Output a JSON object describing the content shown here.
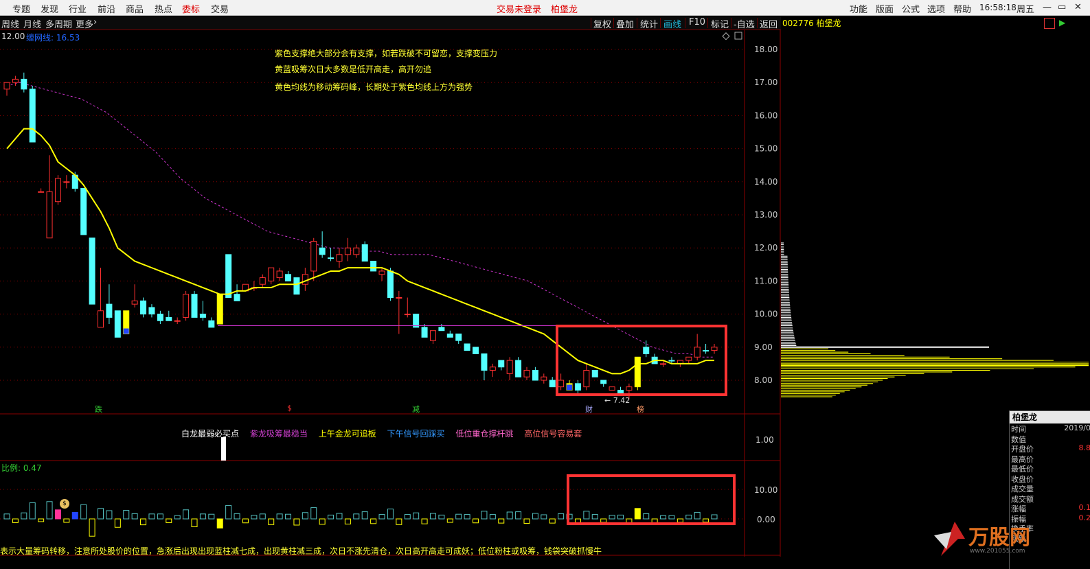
{
  "topbar": {
    "menus": [
      "专题",
      "发现",
      "行业",
      "前沿",
      "商品",
      "热点",
      "委标",
      "交易"
    ],
    "active_menu": "委标",
    "trade_status": "交易未登录",
    "stock_name": "柏堡龙",
    "right_menus": [
      "功能",
      "版面",
      "公式",
      "选项",
      "帮助"
    ],
    "time": "16:58:18",
    "weekday": "周五"
  },
  "toolbar": {
    "left_items": [
      "周线",
      "月线",
      "多周期",
      "更多"
    ],
    "right_buttons": [
      "复权",
      "叠加",
      "统计",
      "画线",
      "F10",
      "标记",
      "-自选",
      "返回"
    ],
    "active_button": "画线",
    "stock_code_label": "002776 柏堡龙"
  },
  "main_chart": {
    "top_label": "12.00",
    "indicator_label": "缠网线: 16.53",
    "annotations": [
      "紫色支撑绝大部分会有支撑，如若跌破不可留恋，支撑变压力",
      "黄蓝吸筹次日大多数是低开高走，高开勿追",
      "黄色均线为移动筹码峰，长期处于紫色均线上方为强势"
    ],
    "price_ticks": [
      "18.00",
      "17.00",
      "16.00",
      "15.00",
      "14.00",
      "13.00",
      "12.00",
      "11.00",
      "10.00",
      "9.00",
      "8.00"
    ],
    "low_label": "← 7.42",
    "event_markers": [
      "跌",
      "$",
      "减",
      "财",
      "榜"
    ]
  },
  "signal_panel": {
    "labels": [
      {
        "text": "白龙最弱必买点",
        "color": "#ffffff"
      },
      {
        "text": "紫龙吸筹最稳当",
        "color": "#d040d0"
      },
      {
        "text": "上午金龙可追板",
        "color": "#ffff00"
      },
      {
        "text": "下午信号回踩买",
        "color": "#3399ff"
      },
      {
        "text": "低位重仓撑杆跳",
        "color": "#ff66cc"
      },
      {
        "text": "高位信号容易套",
        "color": "#ff6666"
      }
    ],
    "tick": "1.00"
  },
  "volume_panel": {
    "ratio_label": "比例: 0.47",
    "ticks": [
      "10.00",
      "0.00"
    ],
    "bottom_note": "表示大量筹码转移，注意所处股价的位置，急涨后出现出现蓝柱减七成，出现黄柱减三成，次日不涨先清仓，次日高开高走可成妖；低位粉柱或吸筹，钱袋突破抓慢牛"
  },
  "info_panel": {
    "title": "柏堡龙",
    "rows": [
      {
        "label": "时间",
        "value": "2019/0"
      },
      {
        "label": "数值",
        "value": ""
      },
      {
        "label": "开盘价",
        "value": "8.8"
      },
      {
        "label": "最高价",
        "value": ""
      },
      {
        "label": "最低价",
        "value": ""
      },
      {
        "label": "收盘价",
        "value": ""
      },
      {
        "label": "成交量",
        "value": ""
      },
      {
        "label": "成交额",
        "value": ""
      },
      {
        "label": "涨幅",
        "value": "0.1"
      },
      {
        "label": "振幅",
        "value": "0.2"
      },
      {
        "label": "换手率",
        "value": ""
      },
      {
        "label": "涨跌",
        "value": ""
      }
    ]
  },
  "watermark": {
    "text": "万股网",
    "url": "www.201055.com"
  },
  "chart_data": {
    "type": "candlestick",
    "price_range": [
      7.0,
      18.5
    ],
    "candles": [
      {
        "o": 16.8,
        "h": 17.0,
        "l": 16.6,
        "c": 17.0,
        "col": "red"
      },
      {
        "o": 17.0,
        "h": 17.2,
        "l": 16.9,
        "c": 17.1,
        "col": "red"
      },
      {
        "o": 17.1,
        "h": 17.3,
        "l": 16.7,
        "c": 16.8,
        "col": "cyan"
      },
      {
        "o": 16.8,
        "h": 16.9,
        "l": 15.2,
        "c": 15.2,
        "col": "cyan"
      },
      {
        "o": 13.7,
        "h": 13.8,
        "l": 13.7,
        "c": 13.7,
        "col": "red"
      },
      {
        "o": 12.3,
        "h": 14.8,
        "l": 12.3,
        "c": 13.7,
        "col": "red"
      },
      {
        "o": 13.4,
        "h": 14.2,
        "l": 13.3,
        "c": 14.1,
        "col": "red"
      },
      {
        "o": 14.0,
        "h": 14.2,
        "l": 13.8,
        "c": 14.0,
        "col": "red"
      },
      {
        "o": 14.2,
        "h": 14.3,
        "l": 13.7,
        "c": 13.8,
        "col": "cyan"
      },
      {
        "o": 13.8,
        "h": 13.8,
        "l": 12.4,
        "c": 12.4,
        "col": "cyan"
      },
      {
        "o": 12.3,
        "h": 12.3,
        "l": 10.3,
        "c": 10.3,
        "col": "cyan"
      },
      {
        "o": 9.6,
        "h": 11.4,
        "l": 9.6,
        "c": 10.1,
        "col": "red"
      },
      {
        "o": 10.3,
        "h": 10.9,
        "l": 9.7,
        "c": 9.9,
        "col": "cyan"
      },
      {
        "o": 10.1,
        "h": 10.1,
        "l": 9.3,
        "c": 9.3,
        "col": "cyan"
      },
      {
        "o": 9.4,
        "h": 10.1,
        "l": 9.4,
        "c": 10.1,
        "col": "yellowblue"
      },
      {
        "o": 10.3,
        "h": 10.9,
        "l": 10.2,
        "c": 10.4,
        "col": "red"
      },
      {
        "o": 10.4,
        "h": 10.5,
        "l": 9.9,
        "c": 10.0,
        "col": "cyan"
      },
      {
        "o": 10.2,
        "h": 10.3,
        "l": 9.9,
        "c": 10.0,
        "col": "cyan"
      },
      {
        "o": 10.0,
        "h": 10.1,
        "l": 9.7,
        "c": 9.8,
        "col": "cyan"
      },
      {
        "o": 9.8,
        "h": 10.1,
        "l": 9.8,
        "c": 9.9,
        "col": "cyan"
      },
      {
        "o": 9.8,
        "h": 9.9,
        "l": 9.7,
        "c": 9.8,
        "col": "red"
      },
      {
        "o": 9.9,
        "h": 10.7,
        "l": 9.8,
        "c": 10.6,
        "col": "red"
      },
      {
        "o": 10.6,
        "h": 10.7,
        "l": 9.9,
        "c": 9.9,
        "col": "cyan"
      },
      {
        "o": 10.0,
        "h": 10.4,
        "l": 9.8,
        "c": 9.9,
        "col": "cyan"
      },
      {
        "o": 9.8,
        "h": 9.9,
        "l": 9.6,
        "c": 9.6,
        "col": "cyan"
      },
      {
        "o": 9.7,
        "h": 10.6,
        "l": 9.7,
        "c": 10.6,
        "col": "yellow"
      },
      {
        "o": 11.8,
        "h": 11.8,
        "l": 10.5,
        "c": 10.5,
        "col": "cyan"
      },
      {
        "o": 10.6,
        "h": 10.9,
        "l": 10.4,
        "c": 10.4,
        "col": "cyan"
      },
      {
        "o": 10.7,
        "h": 10.9,
        "l": 10.7,
        "c": 10.9,
        "col": "red"
      },
      {
        "o": 10.8,
        "h": 11.0,
        "l": 10.7,
        "c": 10.8,
        "col": "red"
      },
      {
        "o": 10.9,
        "h": 11.2,
        "l": 10.8,
        "c": 11.1,
        "col": "red"
      },
      {
        "o": 11.0,
        "h": 11.4,
        "l": 10.9,
        "c": 11.4,
        "col": "red"
      },
      {
        "o": 11.3,
        "h": 11.4,
        "l": 11.0,
        "c": 11.1,
        "col": "red"
      },
      {
        "o": 11.2,
        "h": 11.3,
        "l": 11.0,
        "c": 11.0,
        "col": "cyan"
      },
      {
        "o": 11.1,
        "h": 11.1,
        "l": 10.6,
        "c": 10.6,
        "col": "cyan"
      },
      {
        "o": 10.9,
        "h": 11.4,
        "l": 10.7,
        "c": 11.2,
        "col": "red"
      },
      {
        "o": 11.3,
        "h": 12.3,
        "l": 11.0,
        "c": 12.2,
        "col": "red"
      },
      {
        "o": 12.0,
        "h": 12.5,
        "l": 11.7,
        "c": 11.8,
        "col": "cyan"
      },
      {
        "o": 11.7,
        "h": 12.0,
        "l": 11.6,
        "c": 11.7,
        "col": "cyan"
      },
      {
        "o": 11.6,
        "h": 12.0,
        "l": 11.4,
        "c": 11.8,
        "col": "red"
      },
      {
        "o": 11.8,
        "h": 12.3,
        "l": 11.6,
        "c": 12.0,
        "col": "red"
      },
      {
        "o": 12.0,
        "h": 12.1,
        "l": 11.7,
        "c": 11.8,
        "col": "red"
      },
      {
        "o": 12.1,
        "h": 12.2,
        "l": 11.6,
        "c": 11.6,
        "col": "cyan"
      },
      {
        "o": 11.6,
        "h": 11.6,
        "l": 11.3,
        "c": 11.3,
        "col": "cyan"
      },
      {
        "o": 11.3,
        "h": 11.4,
        "l": 11.0,
        "c": 11.2,
        "col": "red"
      },
      {
        "o": 11.3,
        "h": 11.4,
        "l": 10.4,
        "c": 10.5,
        "col": "cyan"
      },
      {
        "o": 10.5,
        "h": 10.7,
        "l": 9.4,
        "c": 10.5,
        "col": "red"
      },
      {
        "o": 10.0,
        "h": 10.5,
        "l": 9.9,
        "c": 10.0,
        "col": "red"
      },
      {
        "o": 10.0,
        "h": 10.0,
        "l": 9.6,
        "c": 9.6,
        "col": "cyan"
      },
      {
        "o": 9.6,
        "h": 9.7,
        "l": 9.3,
        "c": 9.3,
        "col": "cyan"
      },
      {
        "o": 9.5,
        "h": 9.5,
        "l": 9.1,
        "c": 9.2,
        "col": "red"
      },
      {
        "o": 9.6,
        "h": 9.7,
        "l": 9.5,
        "c": 9.5,
        "col": "cyan"
      },
      {
        "o": 9.4,
        "h": 9.5,
        "l": 9.3,
        "c": 9.3,
        "col": "cyan"
      },
      {
        "o": 9.4,
        "h": 9.4,
        "l": 9.1,
        "c": 9.2,
        "col": "cyan"
      },
      {
        "o": 9.1,
        "h": 9.1,
        "l": 8.9,
        "c": 8.9,
        "col": "cyan"
      },
      {
        "o": 9.0,
        "h": 9.0,
        "l": 8.8,
        "c": 8.8,
        "col": "cyan"
      },
      {
        "o": 8.8,
        "h": 8.8,
        "l": 8.0,
        "c": 8.3,
        "col": "cyan"
      },
      {
        "o": 8.3,
        "h": 8.5,
        "l": 8.1,
        "c": 8.4,
        "col": "red"
      },
      {
        "o": 8.6,
        "h": 8.6,
        "l": 8.3,
        "c": 8.4,
        "col": "cyan"
      },
      {
        "o": 8.2,
        "h": 8.7,
        "l": 8.0,
        "c": 8.6,
        "col": "red"
      },
      {
        "o": 8.6,
        "h": 8.7,
        "l": 8.1,
        "c": 8.1,
        "col": "cyan"
      },
      {
        "o": 8.1,
        "h": 8.4,
        "l": 8.0,
        "c": 8.3,
        "col": "red"
      },
      {
        "o": 8.3,
        "h": 8.4,
        "l": 8.0,
        "c": 8.0,
        "col": "cyan"
      },
      {
        "o": 8.0,
        "h": 8.2,
        "l": 7.9,
        "c": 8.1,
        "col": "red"
      },
      {
        "o": 8.0,
        "h": 8.1,
        "l": 7.8,
        "c": 7.8,
        "col": "cyan"
      },
      {
        "o": 7.8,
        "h": 8.2,
        "l": 7.7,
        "c": 8.0,
        "col": "red"
      },
      {
        "o": 7.9,
        "h": 8.0,
        "l": 7.7,
        "c": 7.7,
        "col": "yellowblue"
      },
      {
        "o": 7.7,
        "h": 8.0,
        "l": 7.6,
        "c": 7.9,
        "col": "cyan"
      },
      {
        "o": 7.8,
        "h": 8.5,
        "l": 7.7,
        "c": 8.3,
        "col": "red"
      },
      {
        "o": 8.3,
        "h": 8.3,
        "l": 8.1,
        "c": 8.1,
        "col": "cyan"
      },
      {
        "o": 8.0,
        "h": 8.0,
        "l": 7.8,
        "c": 7.9,
        "col": "cyan"
      },
      {
        "o": 7.8,
        "h": 7.8,
        "l": 7.7,
        "c": 7.7,
        "col": "red"
      },
      {
        "o": 7.7,
        "h": 7.8,
        "l": 7.6,
        "c": 7.6,
        "col": "cyan"
      },
      {
        "o": 7.7,
        "h": 7.9,
        "l": 7.42,
        "c": 7.8,
        "col": "red"
      },
      {
        "o": 7.8,
        "h": 8.7,
        "l": 7.7,
        "c": 8.7,
        "col": "yellow"
      },
      {
        "o": 8.8,
        "h": 9.2,
        "l": 8.7,
        "c": 9.0,
        "col": "cyan"
      },
      {
        "o": 8.7,
        "h": 8.8,
        "l": 8.5,
        "c": 8.5,
        "col": "cyan"
      },
      {
        "o": 8.5,
        "h": 8.6,
        "l": 8.4,
        "c": 8.5,
        "col": "red"
      },
      {
        "o": 8.6,
        "h": 8.7,
        "l": 8.5,
        "c": 8.6,
        "col": "cyan"
      },
      {
        "o": 8.5,
        "h": 8.6,
        "l": 8.4,
        "c": 8.6,
        "col": "red"
      },
      {
        "o": 8.6,
        "h": 8.7,
        "l": 8.5,
        "c": 8.7,
        "col": "red"
      },
      {
        "o": 8.7,
        "h": 9.4,
        "l": 8.6,
        "c": 9.0,
        "col": "red"
      },
      {
        "o": 8.9,
        "h": 9.1,
        "l": 8.8,
        "c": 8.9,
        "col": "cyan"
      },
      {
        "o": 8.9,
        "h": 9.1,
        "l": 8.8,
        "c": 9.0,
        "col": "red"
      }
    ],
    "ma_yellow": [
      15.0,
      15.3,
      15.6,
      15.6,
      15.4,
      15.1,
      14.6,
      14.4,
      14.2,
      13.9,
      13.5,
      13.1,
      12.6,
      12.0,
      11.8,
      11.6,
      11.5,
      11.4,
      11.3,
      11.2,
      11.1,
      11.0,
      10.9,
      10.8,
      10.7,
      10.6,
      10.6,
      10.7,
      10.7,
      10.8,
      10.8,
      10.8,
      10.9,
      10.9,
      10.9,
      11.0,
      11.1,
      11.2,
      11.3,
      11.3,
      11.4,
      11.4,
      11.4,
      11.4,
      11.4,
      11.3,
      11.2,
      11.0,
      10.9,
      10.8,
      10.7,
      10.6,
      10.5,
      10.4,
      10.3,
      10.2,
      10.1,
      10.0,
      9.9,
      9.8,
      9.7,
      9.6,
      9.5,
      9.4,
      9.2,
      9.0,
      8.8,
      8.6,
      8.5,
      8.4,
      8.3,
      8.2,
      8.2,
      8.3,
      8.5,
      8.5,
      8.6,
      8.6,
      8.5,
      8.5,
      8.5,
      8.5,
      8.6,
      8.6
    ],
    "ma_purple": [
      16.9,
      17.0,
      16.9,
      16.8,
      16.7,
      16.6,
      16.5,
      16.3,
      16.1,
      15.8,
      15.5,
      15.2,
      14.9,
      14.5,
      14.1,
      13.8,
      13.5,
      13.3,
      13.1,
      12.9,
      12.7,
      12.5,
      12.4,
      12.3,
      12.2,
      12.1,
      12.0,
      12.0,
      11.9,
      11.9,
      11.9,
      11.8,
      11.8,
      11.8,
      11.8,
      11.7,
      11.6,
      11.5,
      11.4,
      11.3,
      11.2,
      11.1,
      11.0,
      10.8,
      10.6,
      10.4,
      10.2,
      10.0,
      9.8,
      9.6,
      9.4,
      9.2,
      9.0,
      8.9,
      8.8,
      8.8,
      8.7,
      8.7
    ],
    "support_line_price": 9.65,
    "chip_distribution": "yellow and white horizontal bars on right side, peak near 8.5"
  }
}
